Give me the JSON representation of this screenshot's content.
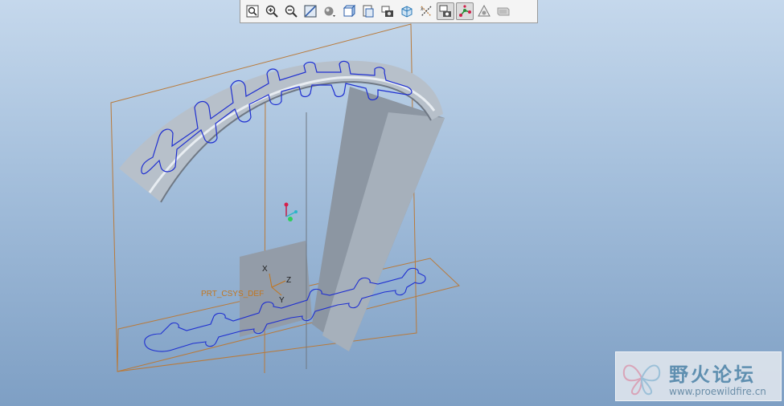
{
  "toolbar": {
    "buttons": [
      {
        "icon": "zoom-fit-icon",
        "pressed": false
      },
      {
        "icon": "zoom-in-icon",
        "pressed": false
      },
      {
        "icon": "zoom-out-icon",
        "pressed": false
      },
      {
        "icon": "refit-view-icon",
        "pressed": false
      },
      {
        "icon": "display-style-icon",
        "pressed": false
      },
      {
        "icon": "saved-orientations-icon",
        "pressed": false
      },
      {
        "icon": "view-manager-icon",
        "pressed": false
      },
      {
        "icon": "perspective-view-icon",
        "pressed": false
      },
      {
        "icon": "section-view-icon",
        "pressed": false
      },
      {
        "icon": "datum-display-icon",
        "pressed": false
      },
      {
        "icon": "annotation-display-icon",
        "pressed": true
      },
      {
        "icon": "spin-center-icon",
        "pressed": true
      },
      {
        "icon": "appearance-icon",
        "pressed": false
      },
      {
        "icon": "render-icon",
        "pressed": false
      }
    ]
  },
  "model": {
    "csys_label": "PRT_CSYS_DEF",
    "axis_x": "X",
    "axis_y": "Y",
    "axis_z": "Z"
  },
  "colors": {
    "datum_plane": "#b97a3a",
    "sketch": "#1f2fd1",
    "part_light": "#cfd6df",
    "part_mid": "#a9b2bd",
    "part_dark": "#7d8793"
  },
  "watermark": {
    "title": "野火论坛",
    "url": "www.proewildfire.cn"
  }
}
